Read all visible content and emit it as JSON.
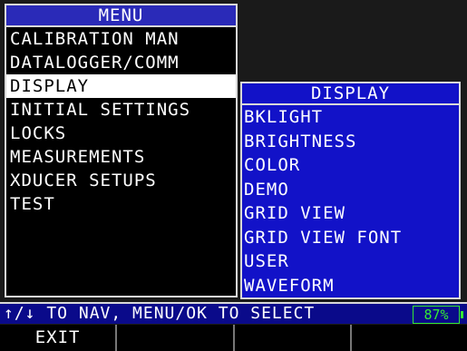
{
  "menu": {
    "title": "MENU",
    "items": [
      {
        "label": "CALIBRATION MAN"
      },
      {
        "label": "DATALOGGER/COMM"
      },
      {
        "label": "DISPLAY"
      },
      {
        "label": "INITIAL SETTINGS"
      },
      {
        "label": "LOCKS"
      },
      {
        "label": "MEASUREMENTS"
      },
      {
        "label": "XDUCER SETUPS"
      },
      {
        "label": "TEST"
      }
    ],
    "selected_index": 2
  },
  "submenu": {
    "title": "DISPLAY",
    "items": [
      {
        "label": "BKLIGHT"
      },
      {
        "label": "BRIGHTNESS"
      },
      {
        "label": "COLOR"
      },
      {
        "label": "DEMO"
      },
      {
        "label": "GRID VIEW"
      },
      {
        "label": "GRID VIEW FONT"
      },
      {
        "label": "USER"
      },
      {
        "label": "WAVEFORM"
      }
    ]
  },
  "status_bar": {
    "nav_hint": "↑/↓ TO NAV, MENU/OK TO SELECT",
    "battery": "87%"
  },
  "softkeys": [
    "EXIT",
    "",
    "",
    ""
  ],
  "colors": {
    "menu_title_bg": "#2a2ab8",
    "submenu_bg": "#1212c8",
    "status_bg": "#0a0a8a",
    "battery": "#34e834",
    "selected_bg": "#ffffff"
  }
}
